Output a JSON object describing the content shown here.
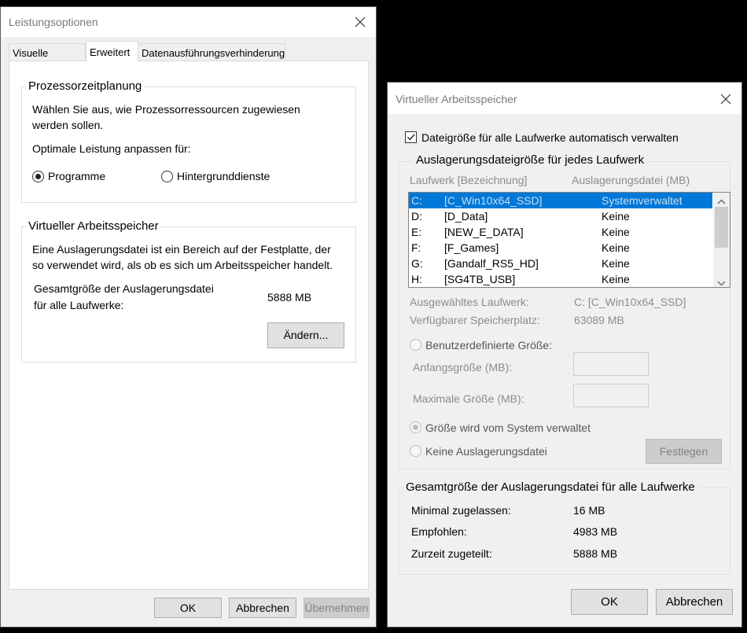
{
  "perf_window": {
    "title": "Leistungsoptionen",
    "tabs": [
      "Visuelle Effekte",
      "Erweitert",
      "Datenausführungsverhinderung"
    ],
    "processor": {
      "title": "Prozessorzeitplanung",
      "desc_line1": "Wählen Sie aus, wie Prozessorressourcen zugewiesen",
      "desc_line2": "werden sollen.",
      "optimize_label": "Optimale Leistung anpassen für:",
      "option_programs": "Programme",
      "option_background": "Hintergrunddienste",
      "selected": "Programme"
    },
    "virtual_memory": {
      "title": "Virtueller Arbeitsspeicher",
      "desc_line1": "Eine Auslagerungsdatei ist ein Bereich auf der Festplatte, der",
      "desc_line2": "so verwendet wird, als ob es sich um Arbeitsspeicher handelt.",
      "total_label_line1": "Gesamtgröße der Auslagerungsdatei",
      "total_label_line2": "für alle Laufwerke:",
      "total_value": "5888 MB",
      "change_button": "Ändern..."
    },
    "buttons": {
      "ok": "OK",
      "cancel": "Abbrechen",
      "apply": "Übernehmen"
    }
  },
  "vm_window": {
    "title": "Virtueller Arbeitsspeicher",
    "auto_manage_label": "Dateigröße für alle Laufwerke automatisch verwalten",
    "auto_manage_checked": true,
    "per_drive_group": "Auslagerungsdateigröße für jedes Laufwerk",
    "columns": {
      "drive": "Laufwerk [Bezeichnung]",
      "pagefile": "Auslagerungsdatei (MB)"
    },
    "drives": [
      {
        "letter": "C:",
        "label": "[C_Win10x64_SSD]",
        "pagefile": "Systemverwaltet",
        "selected": true
      },
      {
        "letter": "D:",
        "label": "[D_Data]",
        "pagefile": "Keine",
        "selected": false
      },
      {
        "letter": "E:",
        "label": "[NEW_E_DATA]",
        "pagefile": "Keine",
        "selected": false
      },
      {
        "letter": "F:",
        "label": "[F_Games]",
        "pagefile": "Keine",
        "selected": false
      },
      {
        "letter": "G:",
        "label": "[Gandalf_RS5_HD]",
        "pagefile": "Keine",
        "selected": false
      },
      {
        "letter": "H:",
        "label": "[SG4TB_USB]",
        "pagefile": "Keine",
        "selected": false
      }
    ],
    "selected_drive_label": "Ausgewähltes Laufwerk:",
    "selected_drive_value": "C:  [C_Win10x64_SSD]",
    "free_space_label": "Verfügbarer Speicherplatz:",
    "free_space_value": "63089 MB",
    "custom_size_label": "Benutzerdefinierte Größe:",
    "initial_size_label": "Anfangsgröße (MB):",
    "initial_size_value": "",
    "max_size_label": "Maximale Größe (MB):",
    "max_size_value": "",
    "system_managed_label": "Größe wird vom System verwaltet",
    "no_pagefile_label": "Keine Auslagerungsdatei",
    "set_button": "Festlegen",
    "totals_group": "Gesamtgröße der Auslagerungsdatei für alle Laufwerke",
    "min_label": "Minimal zugelassen:",
    "min_value": "16 MB",
    "recommended_label": "Empfohlen:",
    "recommended_value": "4983 MB",
    "current_label": "Zurzeit zugeteilt:",
    "current_value": "5888 MB",
    "ok_button": "OK",
    "cancel_button": "Abbrechen"
  },
  "colors": {
    "selection": "#0078d7",
    "window_bg": "#f0f0f0",
    "desktop": "#000000"
  }
}
